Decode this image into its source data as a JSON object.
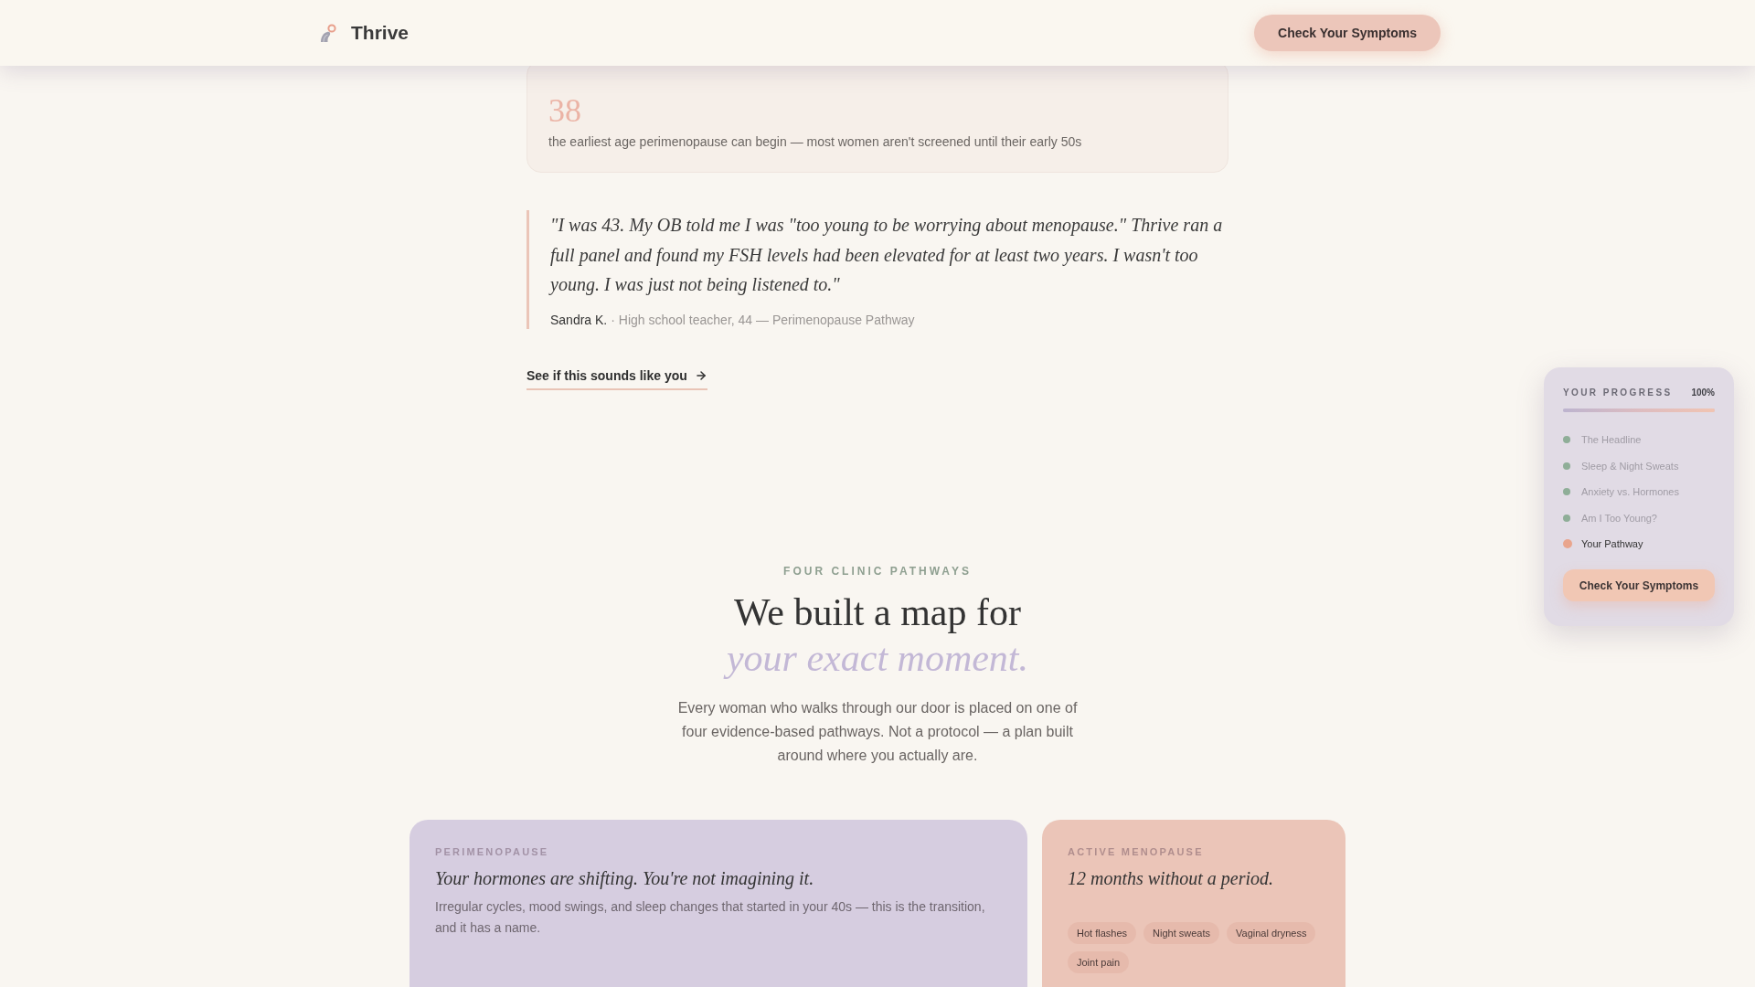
{
  "header": {
    "brand": "Thrive",
    "cta": "Check Your Symptoms"
  },
  "stat": {
    "value": "38",
    "caption": "the earliest age perimenopause can begin — most women aren't screened until their early 50s"
  },
  "testimonial": {
    "quote": "\"I was 43. My OB told me I was \"too young to be worrying about menopause.\" Thrive ran a full panel and found my FSH levels had been elevated for at least two years. I wasn't too young. I was just not being listened to.\"",
    "author": "Sandra K.",
    "detail": "· High school teacher, 44 — Perimenopause Pathway"
  },
  "link": {
    "label": "See if this sounds like you"
  },
  "pathways": {
    "eyebrow": "FOUR CLINIC PATHWAYS",
    "title": "We built a map for",
    "title_accent": "your exact moment.",
    "intro": "Every woman who walks through our door is placed on one of four evidence-based pathways. Not a protocol — a plan built around where you actually are.",
    "cards": [
      {
        "kind": "text",
        "color": "#d6cde0",
        "label": "PERIMENOPAUSE",
        "title": "Your hormones are shifting. You're not imagining it.",
        "body": "Irregular cycles, mood swings, and sleep changes that started in your 40s — this is the transition, and it has a name."
      },
      {
        "kind": "tags",
        "color": "#ebc5b8",
        "label": "ACTIVE MENOPAUSE",
        "title": "12 months without a period.",
        "tags": [
          "Hot flashes",
          "Night sweats",
          "Vaginal dryness",
          "Joint pain"
        ]
      }
    ]
  },
  "progress": {
    "title": "YOUR PROGRESS",
    "percent": "100%",
    "level": 1,
    "items": [
      {
        "label": "The Headline",
        "selected": false
      },
      {
        "label": "Sleep & Night Sweats",
        "selected": false
      },
      {
        "label": "Anxiety vs. Hormones",
        "selected": false
      },
      {
        "label": "Am I Too Young?",
        "selected": false
      },
      {
        "label": "Your Pathway",
        "selected": true
      }
    ],
    "button": "Check Your Symptoms"
  }
}
